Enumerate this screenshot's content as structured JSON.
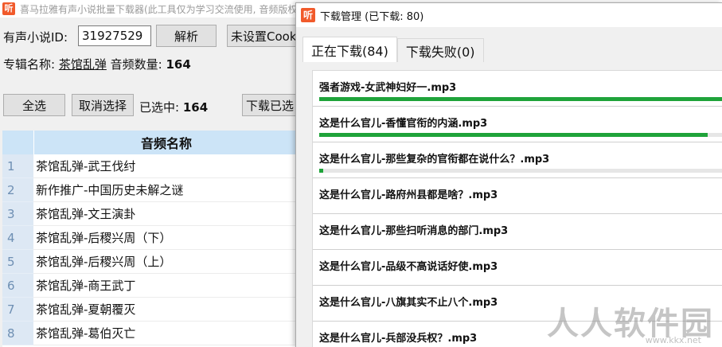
{
  "main": {
    "title": "喜马拉雅有声小说批量下载器(此工具仅为学习交流使用, 音频版权归喜马拉雅所有)",
    "logo_glyph": "听",
    "id_label": "有声小说ID:",
    "id_value": "31927529",
    "parse_button": "解析",
    "cookie_button": "未设置Cookie",
    "album_label": "专辑名称:",
    "album_name": "茶馆乱弹",
    "count_label": "音频数量:",
    "count_value": "164",
    "select_all": "全选",
    "deselect": "取消选择",
    "selected_label": "已选中:",
    "selected_value": "164",
    "download_selected": "下载已选",
    "table": {
      "header": "音频名称",
      "rows": [
        {
          "idx": "1",
          "name": "茶馆乱弹-武王伐纣"
        },
        {
          "idx": "2",
          "name": "新作推广-中国历史未解之谜"
        },
        {
          "idx": "3",
          "name": "茶馆乱弹-文王演卦"
        },
        {
          "idx": "4",
          "name": "茶馆乱弹-后稷兴周（下）"
        },
        {
          "idx": "5",
          "name": "茶馆乱弹-后稷兴周（上）"
        },
        {
          "idx": "6",
          "name": "茶馆乱弹-商王武丁"
        },
        {
          "idx": "7",
          "name": "茶馆乱弹-夏朝覆灭"
        },
        {
          "idx": "8",
          "name": "茶馆乱弹-葛伯灭亡"
        }
      ]
    }
  },
  "dialog": {
    "logo_glyph": "听",
    "title": "下载管理 (已下载: 80)",
    "tabs": [
      {
        "label": "正在下载(84)",
        "active": true
      },
      {
        "label": "下载失败(0)",
        "active": false
      }
    ],
    "items": [
      {
        "name": "强者游戏-女武神妇好一.mp3",
        "progress": 1.0
      },
      {
        "name": "这是什么官儿-香懂官衔的内涵.mp3",
        "progress": 0.96
      },
      {
        "name": "这是什么官儿-那些复杂的官衔都在说什么？.mp3",
        "progress": 0.01
      },
      {
        "name": "这是什么官儿-路府州县都是啥？.mp3"
      },
      {
        "name": "这是什么官儿-那些扫听消息的部门.mp3"
      },
      {
        "name": "这是什么官儿-品级不高说话好使.mp3"
      },
      {
        "name": "这是什么官儿-八旗其实不止八个.mp3"
      },
      {
        "name": "这是什么官儿-兵部没兵权？.mp3"
      }
    ],
    "colors": {
      "progress": "#1fa33a",
      "track": "#e6e6e6"
    }
  },
  "watermark": {
    "text": "人人软件园",
    "url": "www.kkx.net"
  }
}
